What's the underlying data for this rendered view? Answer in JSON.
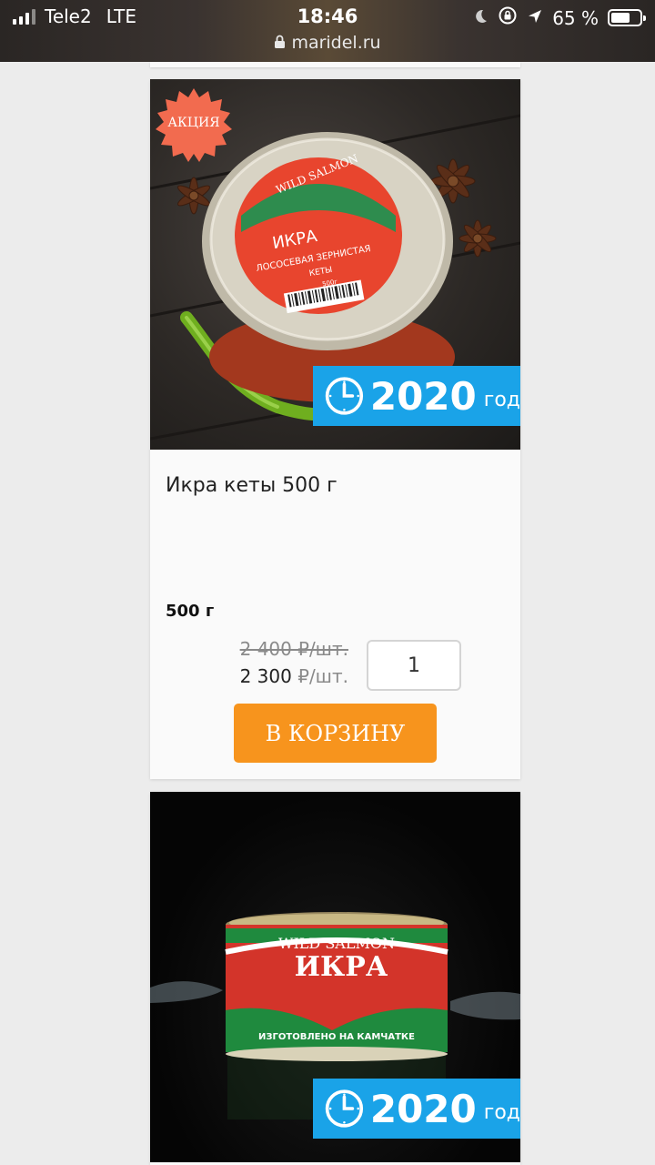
{
  "status_bar": {
    "carrier": "Tele2",
    "network": "LTE",
    "time": "18:46",
    "url": "maridel.ru",
    "battery_percent": "65 %",
    "battery_level": 0.65
  },
  "products": [
    {
      "sale_badge": "АКЦИЯ",
      "year": "2020",
      "year_unit": "год",
      "name": "Икра кеты 500 г",
      "weight": "500 г",
      "old_price": "2 400 ₽/шт.",
      "price_value": "2 300",
      "price_unit": "₽/шт.",
      "quantity": "1",
      "cart_button": "В КОРЗИНУ",
      "package_brand": "WILD SALMON",
      "package_title": "ИКРА",
      "package_subtitle": "ЛОСОСЕВАЯ ЗЕРНИСТАЯ",
      "package_fish": "КЕТЫ",
      "package_weight": "500г"
    },
    {
      "year": "2020",
      "year_unit": "год",
      "package_brand": "WILD SALMON",
      "package_title": "ИКРА",
      "package_footer": "ИЗГОТОВЛЕНО НА КАМЧАТКЕ"
    }
  ],
  "colors": {
    "accent_orange": "#f7941d",
    "year_tag_blue": "#1aa3e8",
    "sale_badge": "#f26b4f"
  }
}
